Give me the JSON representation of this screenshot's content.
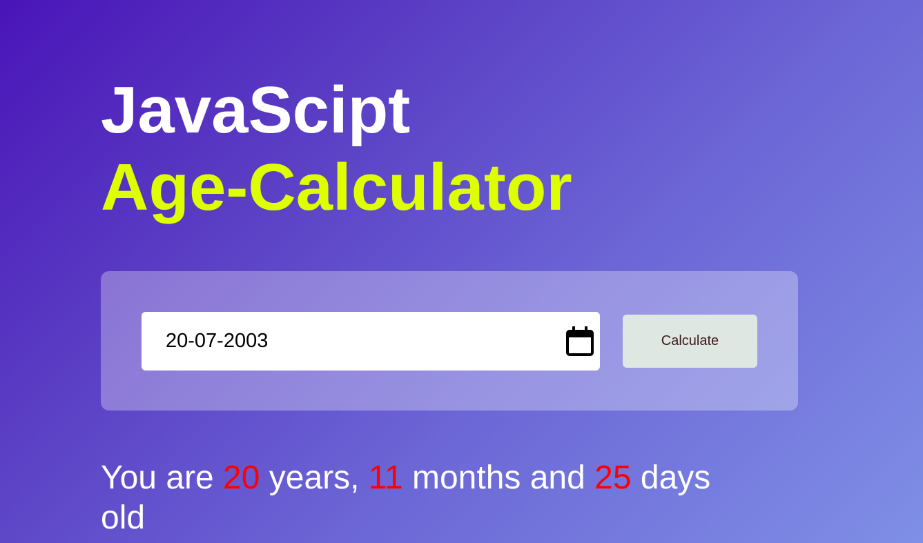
{
  "header": {
    "title_line1": "JavaScipt",
    "title_line2": "Age-Calculator"
  },
  "form": {
    "date_value": "20-07-2003",
    "calendar_icon": "calendar-icon",
    "button_label": "Calculate"
  },
  "result": {
    "prefix": "You are ",
    "years": "20",
    "years_suffix": " years, ",
    "months": "11",
    "months_suffix": " months and ",
    "days": "25",
    "days_suffix": " days old"
  },
  "colors": {
    "title_primary": "#ffffff",
    "title_accent": "#ddff00",
    "result_number": "#ff0000",
    "button_bg": "#dfe7e2"
  }
}
